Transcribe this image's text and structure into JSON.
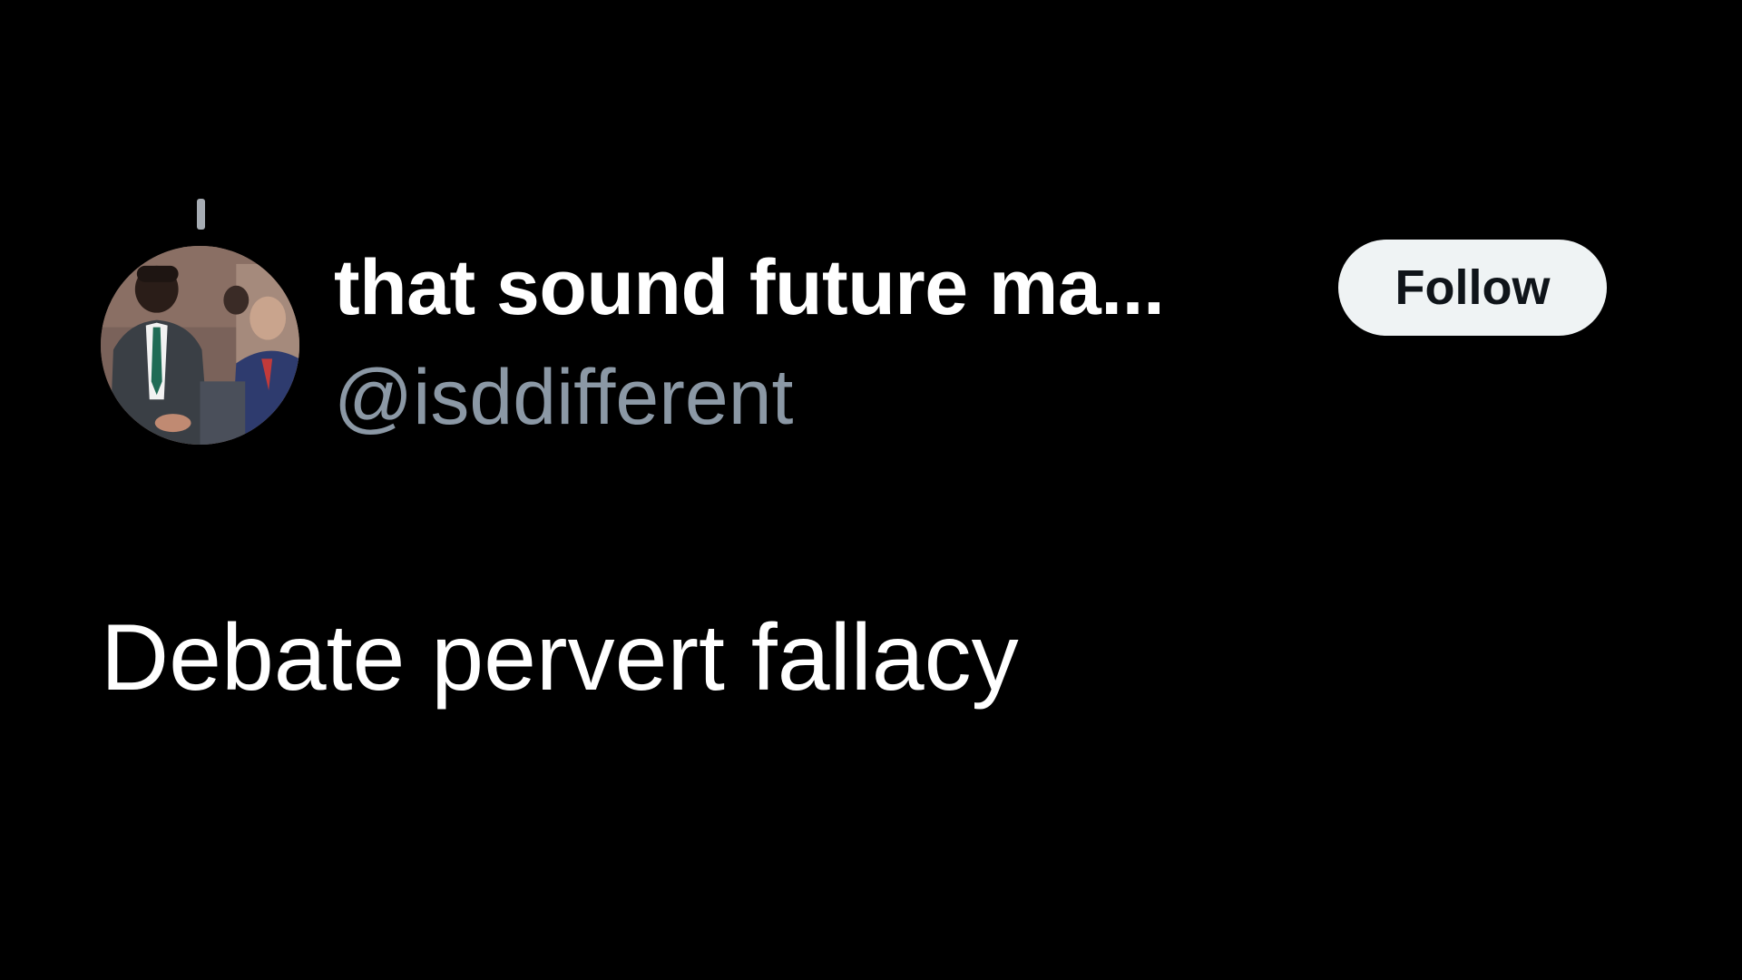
{
  "tweet": {
    "author": {
      "display_name": "that sound future ma...",
      "handle": "@isddifferent",
      "avatar_icon": "profile-photo"
    },
    "follow_label": "Follow",
    "text": "Debate pervert fallacy"
  },
  "colors": {
    "background": "#000000",
    "primary_text": "#ffffff",
    "secondary_text": "#8b98a5",
    "follow_button_bg": "#eff3f4",
    "follow_button_text": "#0f1419",
    "thread_line": "#a6acb3"
  }
}
